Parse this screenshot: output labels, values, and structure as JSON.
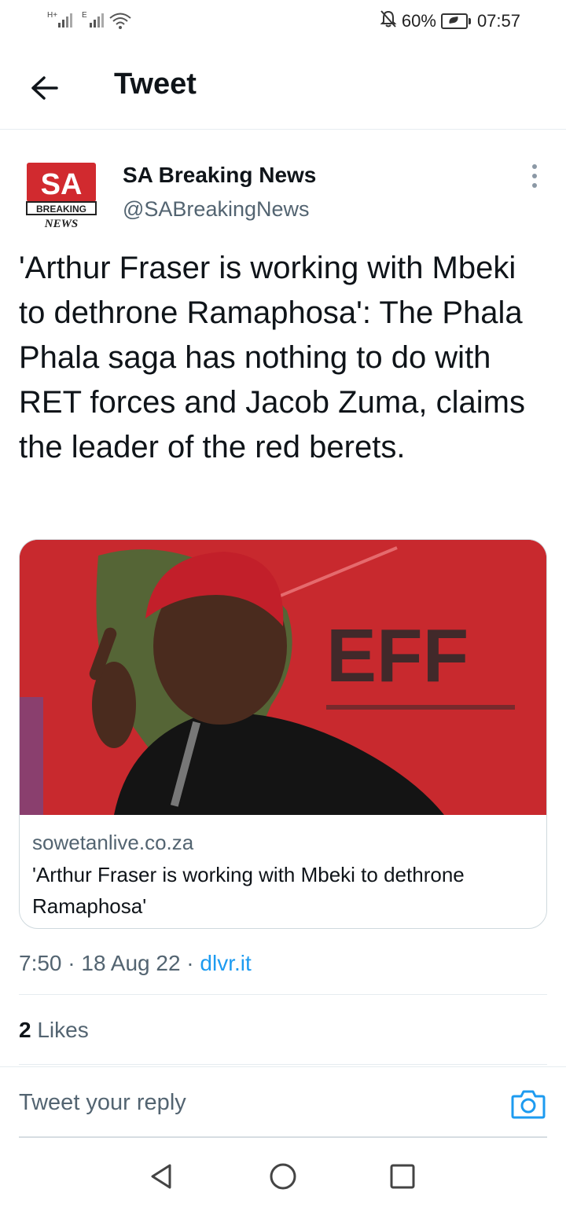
{
  "status_bar": {
    "net1": "H+",
    "net2": "E",
    "battery_pct": "60%",
    "time": "07:57",
    "icons": [
      "signal-h-plus-icon",
      "signal-e-icon",
      "wifi-icon",
      "mute-icon",
      "battery-icon"
    ]
  },
  "header": {
    "title": "Tweet",
    "back_icon": "arrow-left-icon"
  },
  "tweet": {
    "author": {
      "name": "SA Breaking News",
      "handle": "@SABreakingNews",
      "avatar": {
        "line1": "SA",
        "line2": "BREAKING",
        "line3": "NEWS"
      }
    },
    "text": "'Arthur Fraser is working with Mbeki to dethrone Ramaphosa': The Phala Phala saga has nothing to do with RET forces and Jacob Zuma, claims the leader of the red berets.",
    "card": {
      "image_text": "EFF",
      "domain": "sowetanlive.co.za",
      "title": "'Arthur Fraser is working with Mbeki to dethrone Ramaphosa'"
    },
    "time": "7:50",
    "sep1": "·",
    "date": "18 Aug 22",
    "sep2": "·",
    "source": "dlvr.it",
    "likes_count": "2",
    "likes_label": "Likes"
  },
  "reply": {
    "placeholder": "Tweet your reply",
    "camera_icon": "camera-icon"
  },
  "nav": {
    "icons": [
      "nav-back-icon",
      "nav-home-icon",
      "nav-recents-icon"
    ]
  },
  "colors": {
    "accent": "#1d9bf0",
    "text": "#0f1419",
    "muted": "#536471",
    "border": "#cfd9de",
    "card_bg": "#c92a2f"
  }
}
